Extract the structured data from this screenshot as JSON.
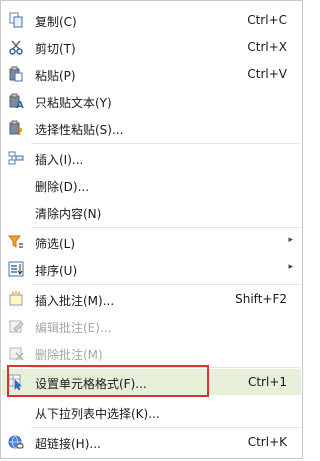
{
  "menu": {
    "items": [
      {
        "label": "复制(C)",
        "shortcut": "Ctrl+C",
        "icon": "copy-icon"
      },
      {
        "label": "剪切(T)",
        "shortcut": "Ctrl+X",
        "icon": "scissors-icon"
      },
      {
        "label": "粘贴(P)",
        "shortcut": "Ctrl+V",
        "icon": "paste-icon"
      },
      {
        "label": "只粘贴文本(Y)",
        "icon": "paste-text-icon"
      },
      {
        "label": "选择性粘贴(S)...",
        "icon": "paste-special-icon"
      },
      {
        "label": "插入(I)...",
        "icon": "insert-icon"
      },
      {
        "label": "删除(D)..."
      },
      {
        "label": "清除内容(N)"
      },
      {
        "label": "筛选(L)",
        "submenu": "▸",
        "icon": "filter-icon"
      },
      {
        "label": "排序(U)",
        "submenu": "▸",
        "icon": "sort-icon"
      },
      {
        "label": "插入批注(M)...",
        "shortcut": "Shift+F2",
        "icon": "insert-comment-icon"
      },
      {
        "label": "编辑批注(E)...",
        "disabled": true,
        "icon": "edit-comment-icon"
      },
      {
        "label": "删除批注(M)",
        "disabled": true,
        "icon": "delete-comment-icon"
      },
      {
        "label": "设置单元格格式(F)...",
        "shortcut": "Ctrl+1",
        "highlighted": true,
        "icon": "format-cells-icon"
      },
      {
        "label": "从下拉列表中选择(K)..."
      },
      {
        "label": "超链接(H)...",
        "shortcut": "Ctrl+K",
        "icon": "hyperlink-icon"
      }
    ]
  },
  "colors": {
    "highlight_bg": "#e6f0d8",
    "annotation_border": "#e03030",
    "disabled_text": "#a6a6a6"
  }
}
